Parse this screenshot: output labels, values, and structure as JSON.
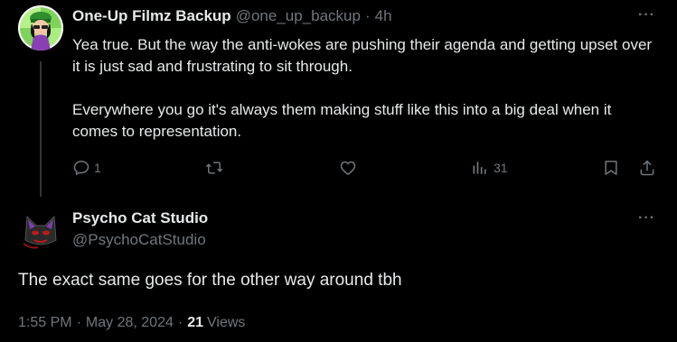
{
  "parent_tweet": {
    "display_name": "One-Up Filmz Backup",
    "handle": "@one_up_backup",
    "separator": "·",
    "time": "4h",
    "more_label": "···",
    "text": "Yea true. But the way the anti-wokes are pushing their agenda and getting upset over it is just sad and frustrating to sit through.\n\nEverywhere you go it's always them making stuff like this into a big deal when it comes to representation.",
    "actions": {
      "reply_count": "1",
      "repost_count": "",
      "like_count": "",
      "views_count": "31"
    }
  },
  "main_tweet": {
    "display_name": "Psycho Cat Studio",
    "handle": "@PsychoCatStudio",
    "more_label": "···",
    "text": "The exact same goes for the other way around tbh",
    "time": "1:55 PM",
    "dot1": "·",
    "date": "May 28, 2024",
    "dot2": "·",
    "views_count": "21",
    "views_label": "Views"
  },
  "colors": {
    "background": "#000000",
    "text_primary": "#e7e9ea",
    "text_secondary": "#71767b",
    "thread_line": "#333639"
  }
}
